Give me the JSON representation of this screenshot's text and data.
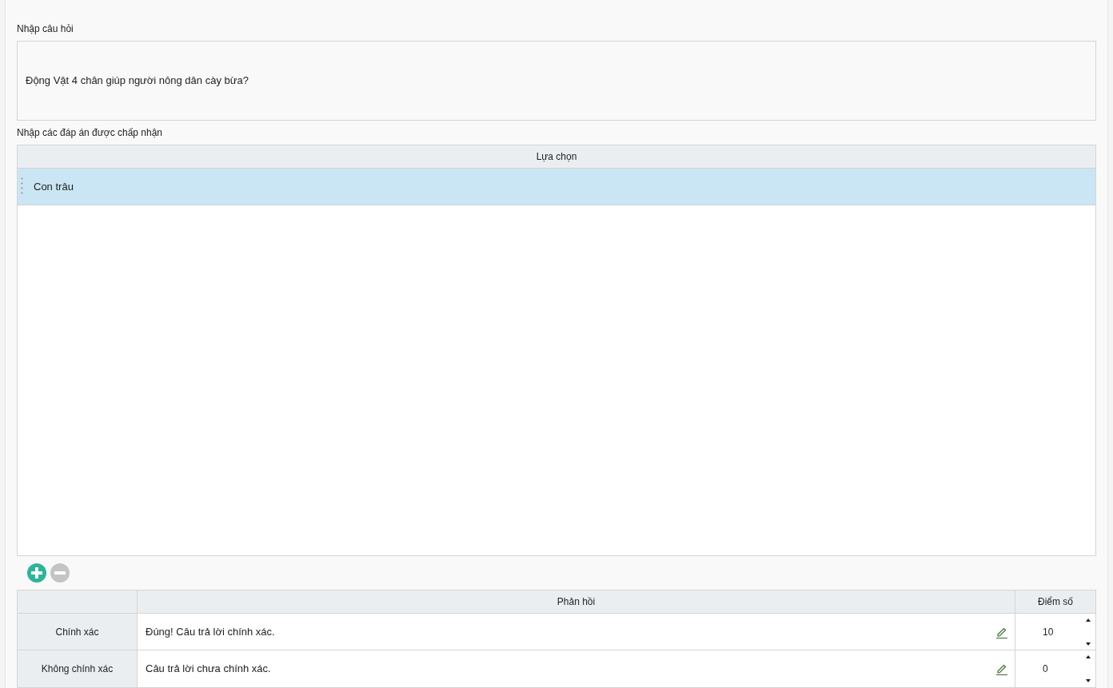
{
  "question": {
    "label": "Nhập câu hỏi",
    "value": "Động Vật 4 chân giúp người nông dân cày bừa?"
  },
  "answers": {
    "label": "Nhập các đáp án được chấp nhận",
    "column": "Lựa chọn",
    "rows": [
      {
        "text": "Con trâu",
        "selected": true
      }
    ]
  },
  "controls": {
    "add_disabled": false,
    "remove_disabled": true
  },
  "feedback": {
    "columns": [
      "Phản hồi",
      "Điểm số"
    ],
    "rows": [
      {
        "label": "Chính xác",
        "text": "Đúng! Câu trả lời chính xác.",
        "score": "10"
      },
      {
        "label": "Không chính xác",
        "text": "Câu trả lời chưa chính xác.",
        "score": "0"
      }
    ]
  }
}
